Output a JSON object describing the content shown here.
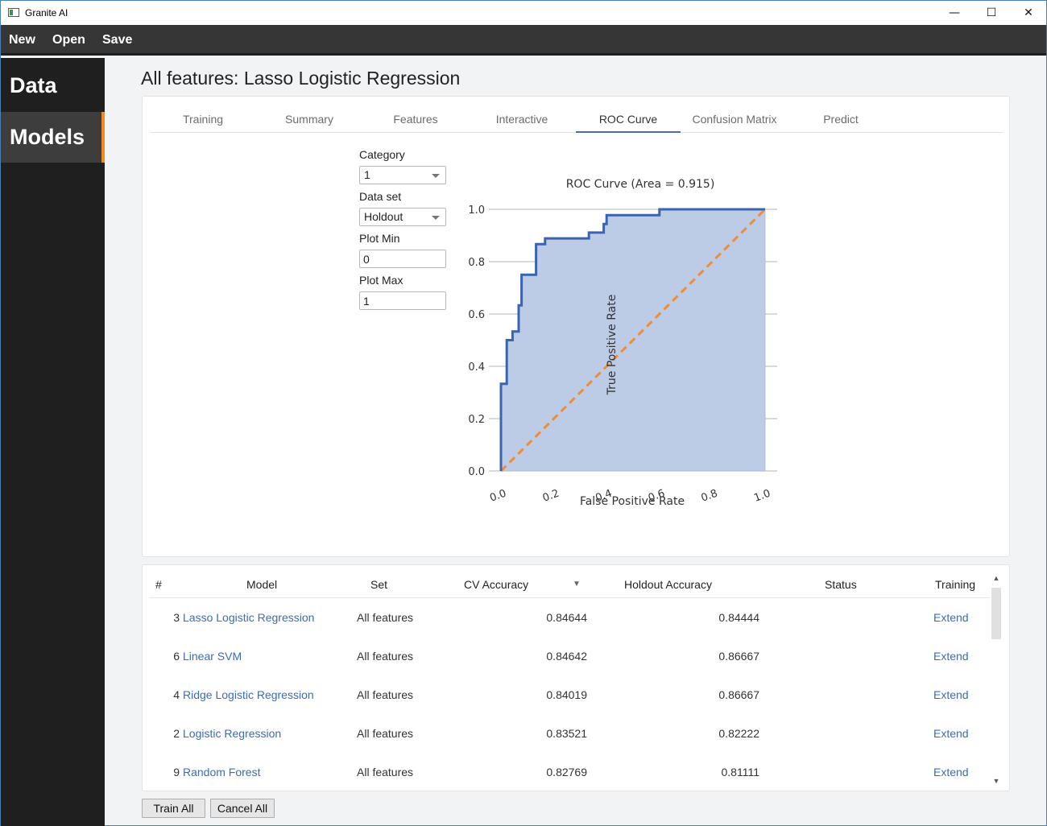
{
  "window": {
    "title": "Granite AI",
    "minimize": "—",
    "maximize": "☐",
    "close": "✕"
  },
  "menu": {
    "new": "New",
    "open": "Open",
    "save": "Save"
  },
  "sidebar": {
    "items": [
      {
        "label": "Data"
      },
      {
        "label": "Models"
      }
    ]
  },
  "page": {
    "title": "All features: Lasso Logistic Regression"
  },
  "tabs": [
    {
      "label": "Training"
    },
    {
      "label": "Summary"
    },
    {
      "label": "Features"
    },
    {
      "label": "Interactive"
    },
    {
      "label": "ROC Curve"
    },
    {
      "label": "Confusion Matrix"
    },
    {
      "label": "Predict"
    }
  ],
  "controls": {
    "category_label": "Category",
    "category_value": "1",
    "dataset_label": "Data set",
    "dataset_value": "Holdout",
    "plot_min_label": "Plot Min",
    "plot_min_value": "0",
    "plot_max_label": "Plot Max",
    "plot_max_value": "1"
  },
  "colors": {
    "accent": "#f08a24",
    "curve": "#3a63b0",
    "fill": "#bccbe6",
    "diagonal": "#f28c33",
    "link": "#3b6cb7"
  },
  "chart_data": {
    "type": "area",
    "title": "ROC Curve (Area = 0.915)",
    "xlabel": "False Positive Rate",
    "ylabel": "True Positive Rate",
    "xlim": [
      0,
      1
    ],
    "ylim": [
      0,
      1
    ],
    "x_ticks": [
      "0.0",
      "0.2",
      "0.4",
      "0.6",
      "0.8",
      "1.0"
    ],
    "y_ticks": [
      "0.0",
      "0.2",
      "0.4",
      "0.6",
      "0.8",
      "1.0"
    ],
    "grid": "horizontal",
    "series": [
      {
        "points": [
          [
            0,
            0
          ],
          [
            0,
            0.333
          ],
          [
            0.022,
            0.333
          ],
          [
            0.022,
            0.5
          ],
          [
            0.044,
            0.5
          ],
          [
            0.044,
            0.533
          ],
          [
            0.067,
            0.533
          ],
          [
            0.067,
            0.633
          ],
          [
            0.067,
            0.633
          ],
          [
            0.078,
            0.633
          ],
          [
            0.078,
            0.75
          ],
          [
            0.133,
            0.75
          ],
          [
            0.133,
            0.867
          ],
          [
            0.167,
            0.867
          ],
          [
            0.167,
            0.889
          ],
          [
            0.333,
            0.889
          ],
          [
            0.333,
            0.911
          ],
          [
            0.389,
            0.911
          ],
          [
            0.389,
            0.944
          ],
          [
            0.4,
            0.944
          ],
          [
            0.4,
            0.978
          ],
          [
            0.6,
            0.978
          ],
          [
            0.6,
            1.0
          ],
          [
            1.0,
            1.0
          ]
        ]
      },
      {
        "points": [
          [
            0,
            0
          ],
          [
            1,
            1
          ]
        ]
      }
    ]
  },
  "table": {
    "headers": {
      "num": "#",
      "model": "Model",
      "set": "Set",
      "cv": "CV Accuracy",
      "holdout": "Holdout Accuracy",
      "status": "Status",
      "training": "Training"
    },
    "rows": [
      {
        "num": "3",
        "model": "Lasso Logistic Regression",
        "set": "All features",
        "cv": "0.84644",
        "holdout": "0.84444",
        "status": "",
        "training": "Extend"
      },
      {
        "num": "6",
        "model": "Linear SVM",
        "set": "All features",
        "cv": "0.84642",
        "holdout": "0.86667",
        "status": "",
        "training": "Extend"
      },
      {
        "num": "4",
        "model": "Ridge Logistic Regression",
        "set": "All features",
        "cv": "0.84019",
        "holdout": "0.86667",
        "status": "",
        "training": "Extend"
      },
      {
        "num": "2",
        "model": "Logistic Regression",
        "set": "All features",
        "cv": "0.83521",
        "holdout": "0.82222",
        "status": "",
        "training": "Extend"
      },
      {
        "num": "9",
        "model": "Random Forest",
        "set": "All features",
        "cv": "0.82769",
        "holdout": "0.81111",
        "status": "",
        "training": "Extend"
      }
    ]
  },
  "buttons": {
    "train_all": "Train All",
    "cancel_all": "Cancel All"
  }
}
